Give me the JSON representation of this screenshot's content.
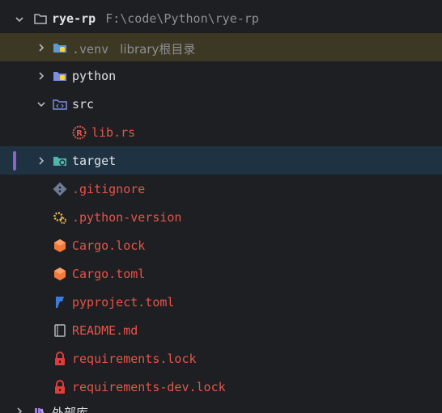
{
  "tree": {
    "root": {
      "name": "rye-rp",
      "path": "F:\\code\\Python\\rye-rp"
    },
    "items": [
      {
        "name": ".venv",
        "hint": "library根目录"
      },
      {
        "name": "python"
      },
      {
        "name": "src"
      },
      {
        "name": "lib.rs"
      },
      {
        "name": "target"
      },
      {
        "name": ".gitignore"
      },
      {
        "name": ".python-version"
      },
      {
        "name": "Cargo.lock"
      },
      {
        "name": "Cargo.toml"
      },
      {
        "name": "pyproject.toml"
      },
      {
        "name": "README.md"
      },
      {
        "name": "requirements.lock"
      },
      {
        "name": "requirements-dev.lock"
      }
    ],
    "partial_bottom": "外部库"
  },
  "colors": {
    "background": "#1e1f22",
    "venv_highlight": "#3d3823",
    "selection": "#1f3242",
    "text_white": "#dfe1e5",
    "text_red": "#e5544a",
    "text_gray": "#8c8f96"
  },
  "icons": [
    "chevron-down-icon",
    "chevron-right-icon",
    "folder-icon",
    "python-folder-icon",
    "source-folder-icon",
    "rust-file-icon",
    "excluded-folder-icon",
    "git-icon",
    "gear-icon",
    "cargo-box-icon",
    "pyproject-icon",
    "readme-icon",
    "lock-icon",
    "library-icon"
  ]
}
